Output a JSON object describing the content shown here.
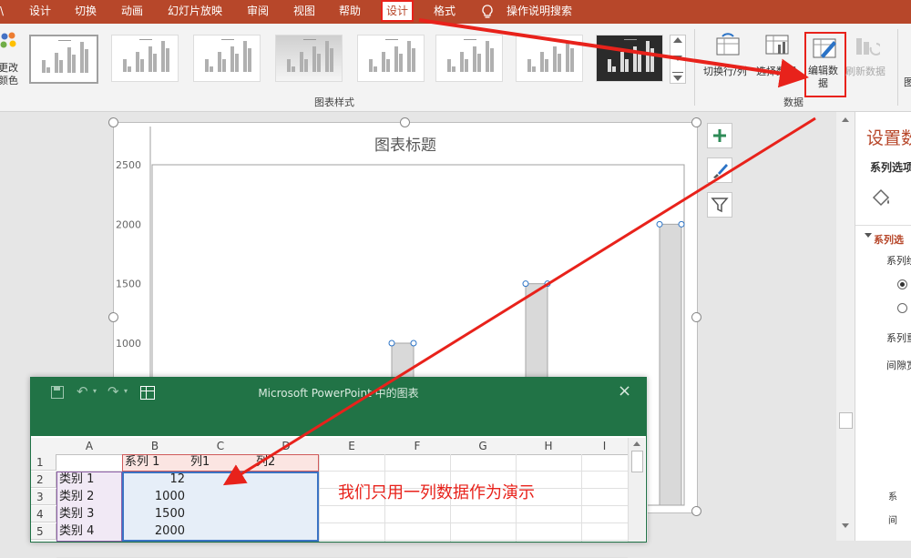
{
  "tabs": [
    "\\",
    "设计",
    "切换",
    "动画",
    "幻灯片放映",
    "审阅",
    "视图",
    "帮助",
    "设计",
    "格式",
    "操作说明搜索"
  ],
  "ribbon": {
    "change_colors": [
      "更改",
      "颜色"
    ],
    "chart_styles_label": "图表样式",
    "switch_rowcol": "切换行/列",
    "select_data": "选择数据",
    "edit_data": [
      "编辑数",
      "据"
    ],
    "refresh_data": "刷新数据",
    "data_group_label": "数据"
  },
  "chart": {
    "title": "图表标题",
    "yticks": [
      "2500",
      "2000",
      "1500",
      "1000"
    ],
    "bar_fill": "#d9d9d9",
    "bar_stroke": "#a6a6a6"
  },
  "chart_data": {
    "type": "bar",
    "title": "图表标题",
    "categories": [
      "类别 1",
      "类别 2",
      "类别 3",
      "类别 4"
    ],
    "series": [
      {
        "name": "系列 1",
        "values": [
          12,
          1000,
          1500,
          2000
        ]
      }
    ],
    "ylim": [
      0,
      2500
    ],
    "yticks": [
      1000,
      1500,
      2000,
      2500
    ],
    "grid": false
  },
  "excel": {
    "title": "Microsoft PowerPoint 中的图表",
    "columns": [
      "A",
      "B",
      "C",
      "D",
      "E",
      "F",
      "G",
      "H",
      "I"
    ],
    "rows": [
      "1",
      "2",
      "3",
      "4",
      "5"
    ],
    "header_row": [
      "",
      "系列 1",
      "列1",
      "列2"
    ],
    "data": [
      [
        "类别 1",
        "12"
      ],
      [
        "类别 2",
        "1000"
      ],
      [
        "类别 3",
        "1500"
      ],
      [
        "类别 4",
        "2000"
      ]
    ],
    "annotation": "我们只用一列数据作为演示",
    "annotation_color": "#e8221b"
  },
  "right_pane": {
    "title": "设置数",
    "series_options": "系列选项",
    "section": "系列选",
    "item1": "系列绘",
    "item2": "系列重",
    "item3": "间隙宽",
    "item4": "系",
    "item5": "间"
  },
  "accent": "#b7472a",
  "arrow_color": "#e8221b"
}
